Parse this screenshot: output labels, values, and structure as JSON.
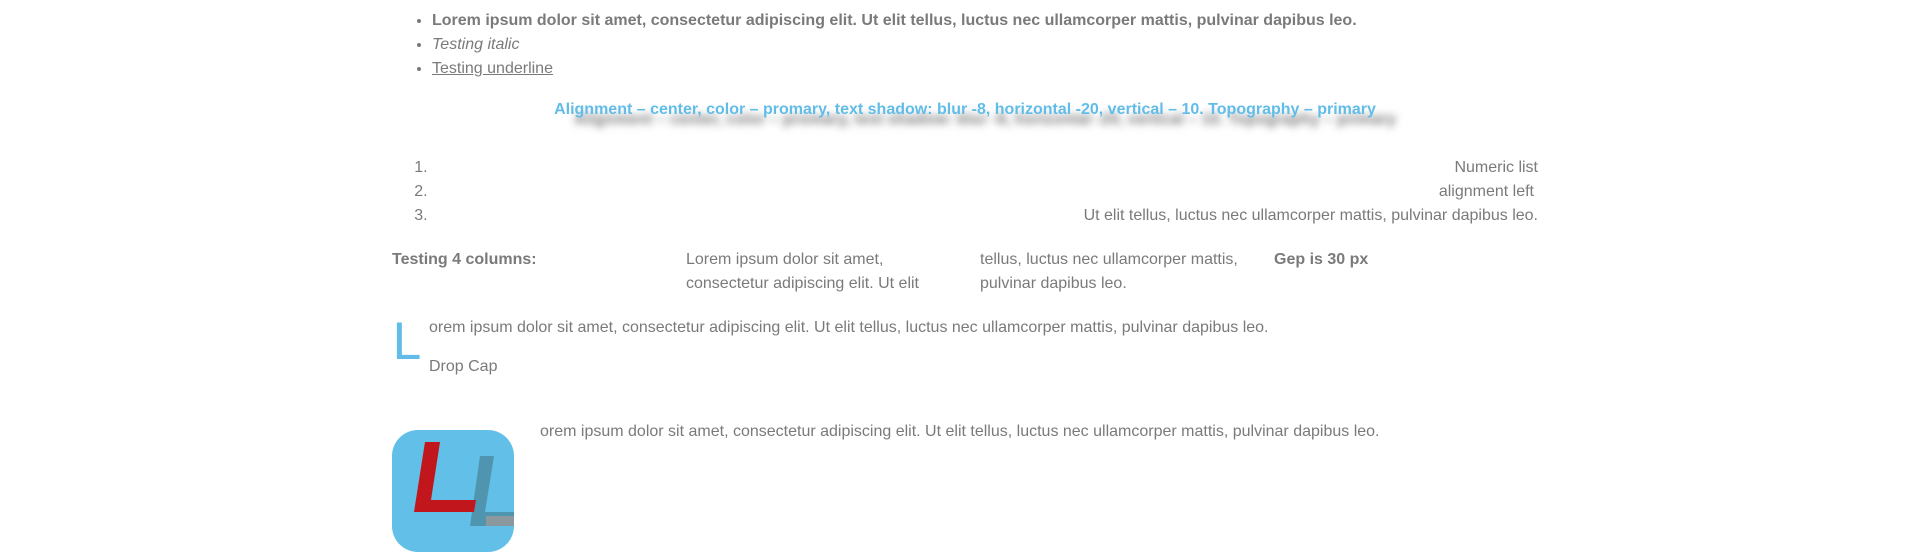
{
  "bullets": {
    "bold": "Lorem ipsum dolor sit amet, consectetur adipiscing elit. Ut elit tellus, luctus nec ullamcorper mattis, pulvinar dapibus leo.",
    "italic": "Testing italic",
    "underline": "Testing underline"
  },
  "shadow_heading": "Alignment – center, color – promary, text shadow: blur -8, horizontal -20, vertical – 10. Topography – primary",
  "numeric_list": [
    "Numeric list",
    "alignment left",
    "Ut elit tellus, luctus nec ullamcorper mattis, pulvinar dapibus leo."
  ],
  "columns": {
    "col1": "Testing 4 columns:",
    "col2": "Lorem ipsum dolor sit amet, consectetur adipiscing elit. Ut elit",
    "col3": "tellus, luctus nec ullamcorper mattis, pulvinar dapibus leo.",
    "col4": "Gep is 30 px"
  },
  "dropcap": {
    "letter": "L",
    "text": "orem ipsum dolor sit amet, consectetur adipiscing elit. Ut elit tellus, luctus nec ullamcorper mattis, pulvinar dapibus leo.",
    "label": "Drop Cap"
  },
  "logo_paragraph": "orem ipsum dolor sit amet, consectetur adipiscing elit. Ut elit tellus, luctus nec ullamcorper mattis, pulvinar dapibus leo.",
  "colors": {
    "primary": "#61bde8",
    "text": "#7a7a7a",
    "logo_red": "#c1161c"
  },
  "icons": {
    "logo": "ll-logo-icon"
  }
}
